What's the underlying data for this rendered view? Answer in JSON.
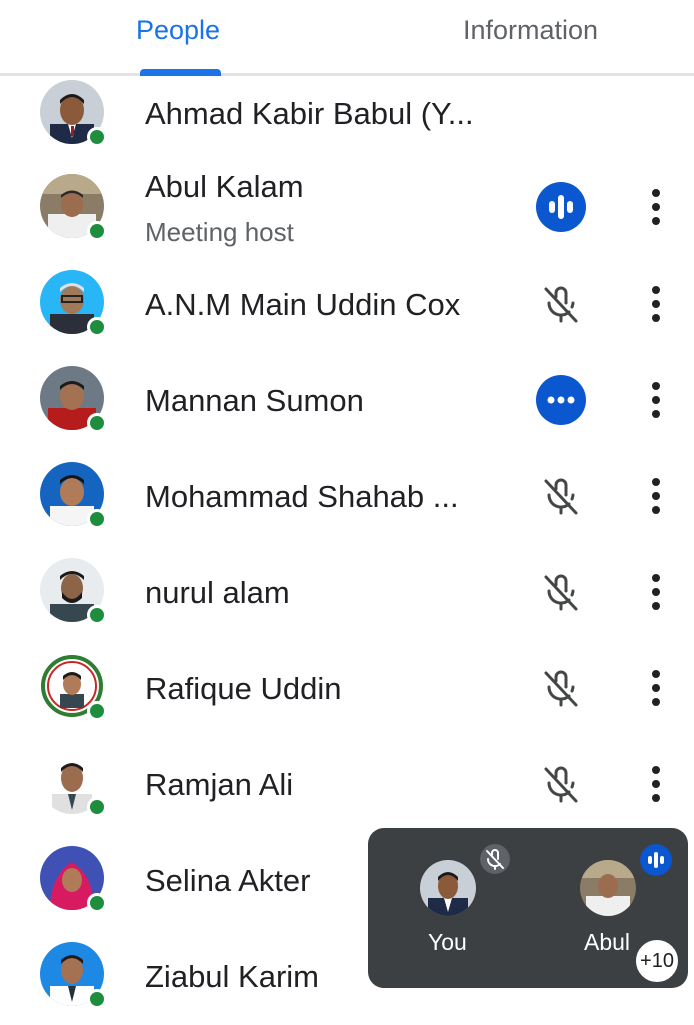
{
  "tabs": {
    "people": "People",
    "information": "Information"
  },
  "participants": [
    {
      "name": "Ahmad Kabir Babul (Y...",
      "subtitle": "",
      "status": "none"
    },
    {
      "name": "Abul Kalam",
      "subtitle": "Meeting host",
      "status": "speaking"
    },
    {
      "name": "A.N.M Main Uddin Cox",
      "subtitle": "",
      "status": "muted"
    },
    {
      "name": "Mannan Sumon",
      "subtitle": "",
      "status": "more-options"
    },
    {
      "name": "Mohammad Shahab ...",
      "subtitle": "",
      "status": "muted"
    },
    {
      "name": "nurul alam",
      "subtitle": "",
      "status": "muted"
    },
    {
      "name": "Rafique Uddin",
      "subtitle": "",
      "status": "muted"
    },
    {
      "name": "Ramjan Ali",
      "subtitle": "",
      "status": "muted"
    },
    {
      "name": "Selina Akter",
      "subtitle": "",
      "status": "none"
    },
    {
      "name": "Ziabul Karim",
      "subtitle": "",
      "status": "muted"
    }
  ],
  "overlay": {
    "you_label": "You",
    "other_label": "Abul",
    "more_count": "+10"
  },
  "colors": {
    "accent": "#1a73e8",
    "online": "#1e8e3e",
    "speaking": "#0b57d0",
    "overlay_bg": "#3c4043"
  },
  "icons": [
    "mic-off-icon",
    "audio-level-icon",
    "more-horiz-icon",
    "more-vert-icon",
    "online-dot-icon"
  ]
}
